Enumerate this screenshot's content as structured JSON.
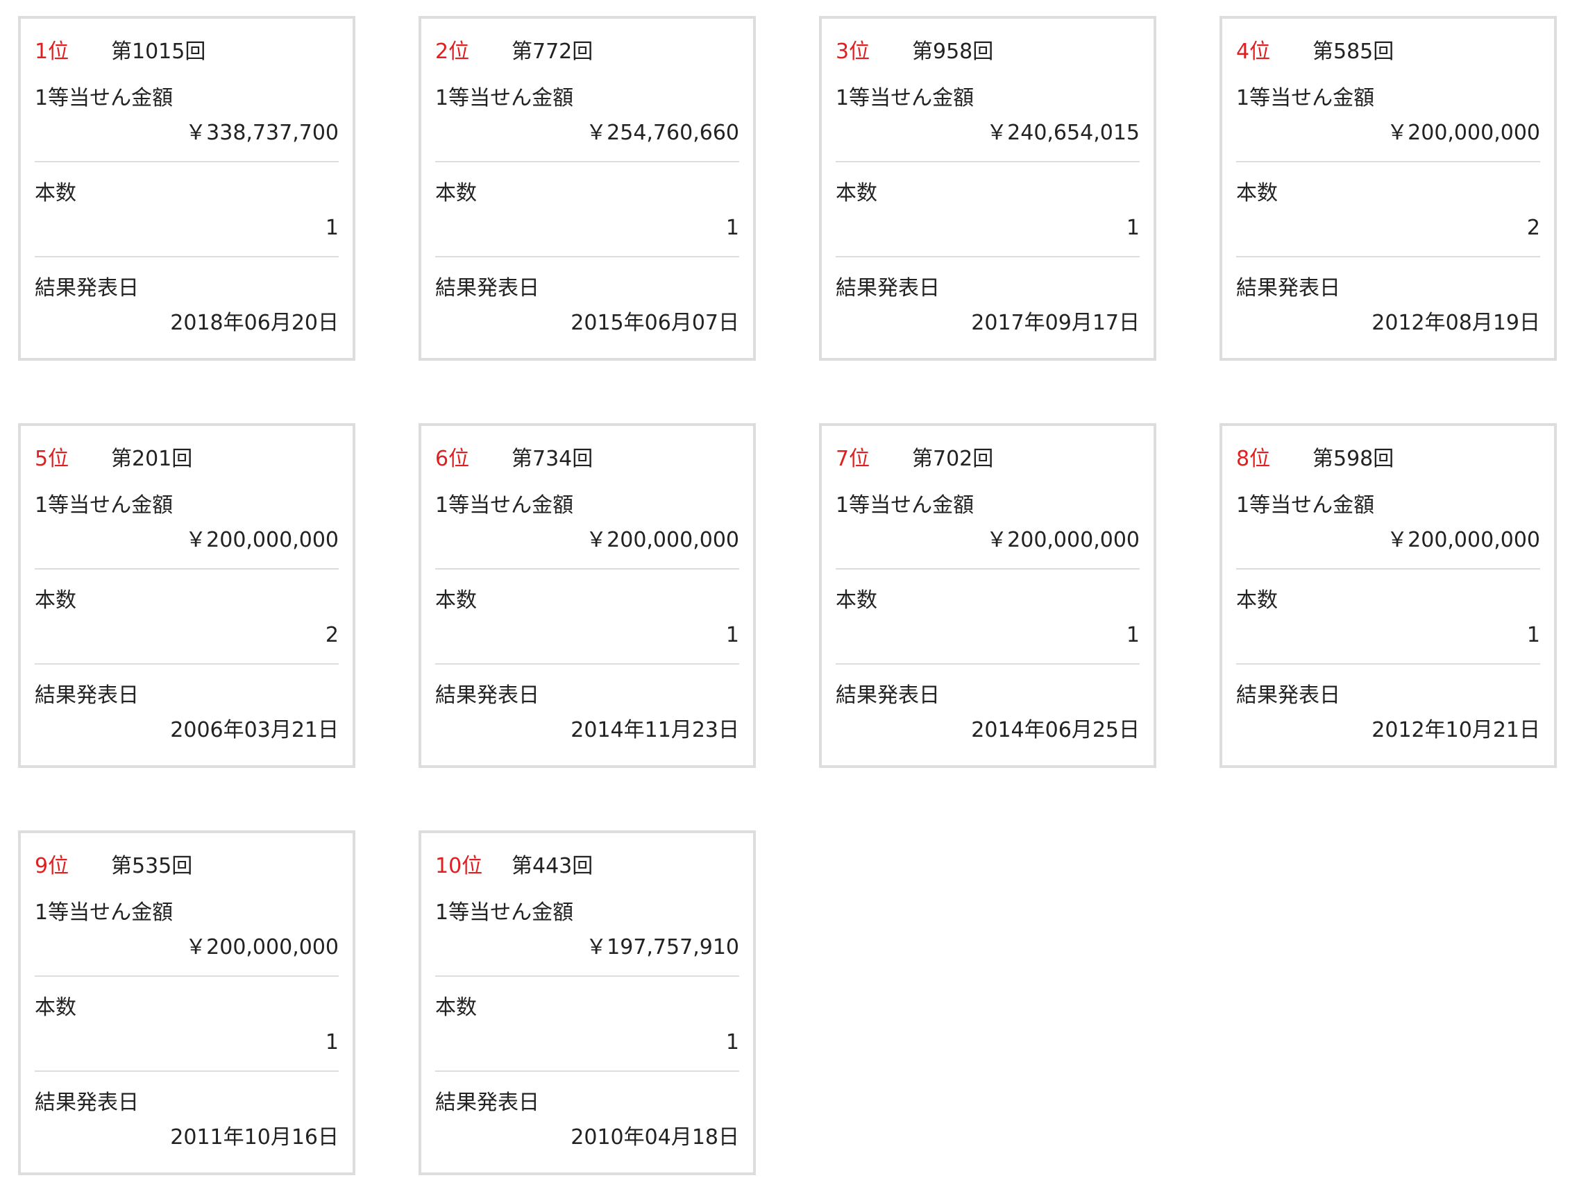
{
  "labels": {
    "prize": "1等当せん金額",
    "count": "本数",
    "date": "結果発表日"
  },
  "cards": [
    {
      "rank": "1位",
      "round": "第1015回",
      "prize": "￥338,737,700",
      "count": "1",
      "date": "2018年06月20日"
    },
    {
      "rank": "2位",
      "round": "第772回",
      "prize": "￥254,760,660",
      "count": "1",
      "date": "2015年06月07日"
    },
    {
      "rank": "3位",
      "round": "第958回",
      "prize": "￥240,654,015",
      "count": "1",
      "date": "2017年09月17日"
    },
    {
      "rank": "4位",
      "round": "第585回",
      "prize": "￥200,000,000",
      "count": "2",
      "date": "2012年08月19日"
    },
    {
      "rank": "5位",
      "round": "第201回",
      "prize": "￥200,000,000",
      "count": "2",
      "date": "2006年03月21日"
    },
    {
      "rank": "6位",
      "round": "第734回",
      "prize": "￥200,000,000",
      "count": "1",
      "date": "2014年11月23日"
    },
    {
      "rank": "7位",
      "round": "第702回",
      "prize": "￥200,000,000",
      "count": "1",
      "date": "2014年06月25日"
    },
    {
      "rank": "8位",
      "round": "第598回",
      "prize": "￥200,000,000",
      "count": "1",
      "date": "2012年10月21日"
    },
    {
      "rank": "9位",
      "round": "第535回",
      "prize": "￥200,000,000",
      "count": "1",
      "date": "2011年10月16日"
    },
    {
      "rank": "10位",
      "round": "第443回",
      "prize": "￥197,757,910",
      "count": "1",
      "date": "2010年04月18日"
    }
  ]
}
